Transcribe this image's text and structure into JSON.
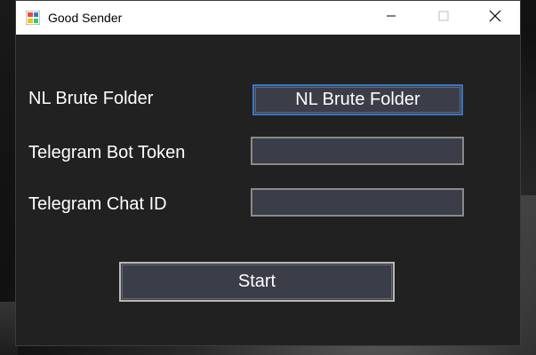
{
  "window": {
    "title": "Good Sender",
    "icon": "app-icon",
    "controls": {
      "minimize_icon": "minimize-icon",
      "maximize_icon": "maximize-icon",
      "close_icon": "close-icon"
    }
  },
  "form": {
    "folder_label": "NL Brute Folder",
    "folder_button_label": "NL Brute Folder",
    "token_label": "Telegram Bot Token",
    "token_value": "",
    "chat_label": "Telegram Chat ID",
    "chat_value": "",
    "start_label": "Start"
  },
  "colors": {
    "window_bg": "#212121",
    "control_bg": "#3b3d48",
    "focus_border": "#3a77c0",
    "text": "#ffffff"
  }
}
